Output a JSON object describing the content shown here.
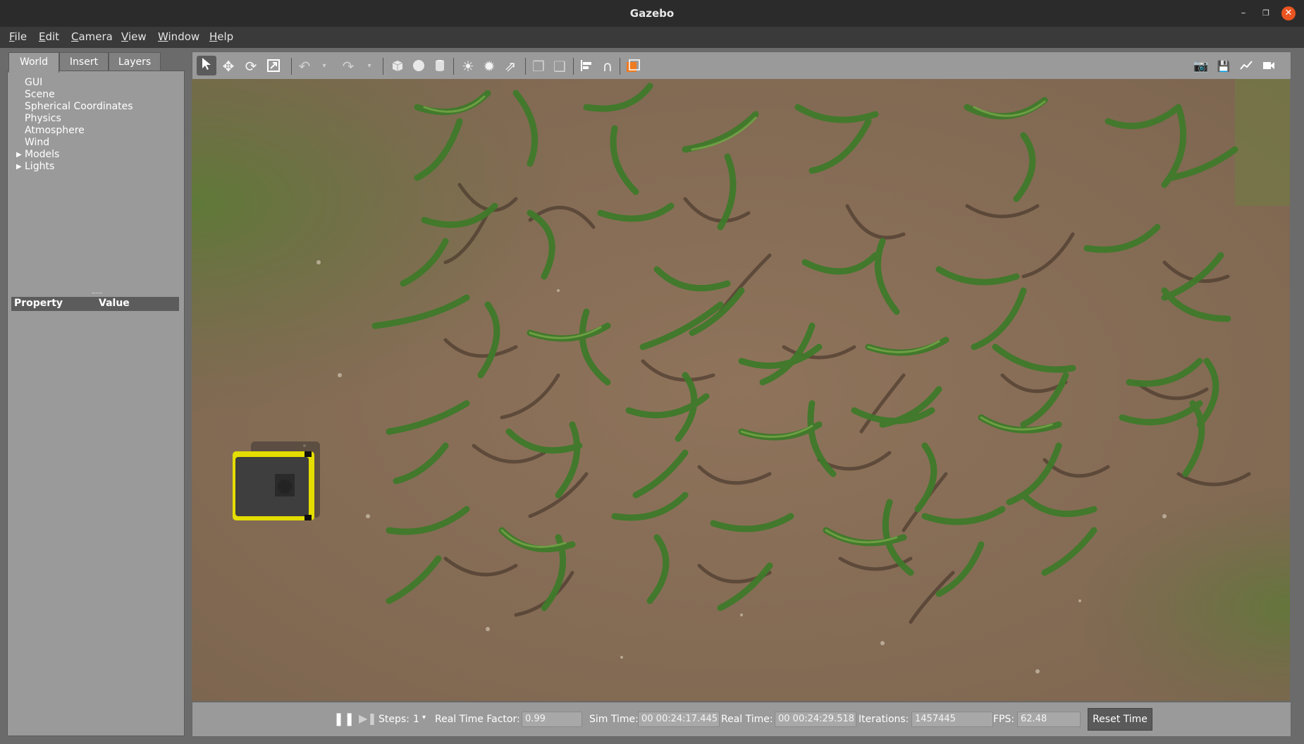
{
  "window": {
    "title": "Gazebo"
  },
  "menu": [
    "File",
    "Edit",
    "Camera",
    "View",
    "Window",
    "Help"
  ],
  "tabs": [
    "World",
    "Insert",
    "Layers"
  ],
  "tree": [
    {
      "label": "GUI",
      "expandable": false
    },
    {
      "label": "Scene",
      "expandable": false
    },
    {
      "label": "Spherical Coordinates",
      "expandable": false
    },
    {
      "label": "Physics",
      "expandable": false
    },
    {
      "label": "Atmosphere",
      "expandable": false
    },
    {
      "label": "Wind",
      "expandable": false
    },
    {
      "label": "Models",
      "expandable": true
    },
    {
      "label": "Lights",
      "expandable": true
    }
  ],
  "properties": {
    "col1": "Property",
    "col2": "Value"
  },
  "toolbar": {
    "icons": [
      "select-mode-icon",
      "translate-icon",
      "rotate-icon",
      "scale-icon",
      "undo-icon",
      "undo-history-icon",
      "redo-icon",
      "redo-history-icon",
      "box-shape-icon",
      "sphere-shape-icon",
      "cylinder-shape-icon",
      "point-light-icon",
      "spot-light-icon",
      "directional-light-icon",
      "copy-icon",
      "paste-icon",
      "align-icon",
      "snap-icon",
      "change-view-icon"
    ],
    "right_icons": [
      "screenshot-icon",
      "log-icon",
      "plot-icon",
      "record-video-icon"
    ]
  },
  "status": {
    "steps_label": "Steps:",
    "steps_value": "1",
    "rtf_label": "Real Time Factor:",
    "rtf_value": "0.99",
    "sim_label": "Sim Time:",
    "sim_value": "00 00:24:17.445",
    "real_label": "Real Time:",
    "real_value": "00 00:24:29.518",
    "iter_label": "Iterations:",
    "iter_value": "1457445",
    "fps_label": "FPS:",
    "fps_value": "62.48",
    "reset_label": "Reset Time"
  },
  "colors": {
    "accent": "#e95420",
    "robot_yellow": "#f2e600",
    "soil": "#8b7159",
    "crop_green": "#3f7a2a"
  }
}
